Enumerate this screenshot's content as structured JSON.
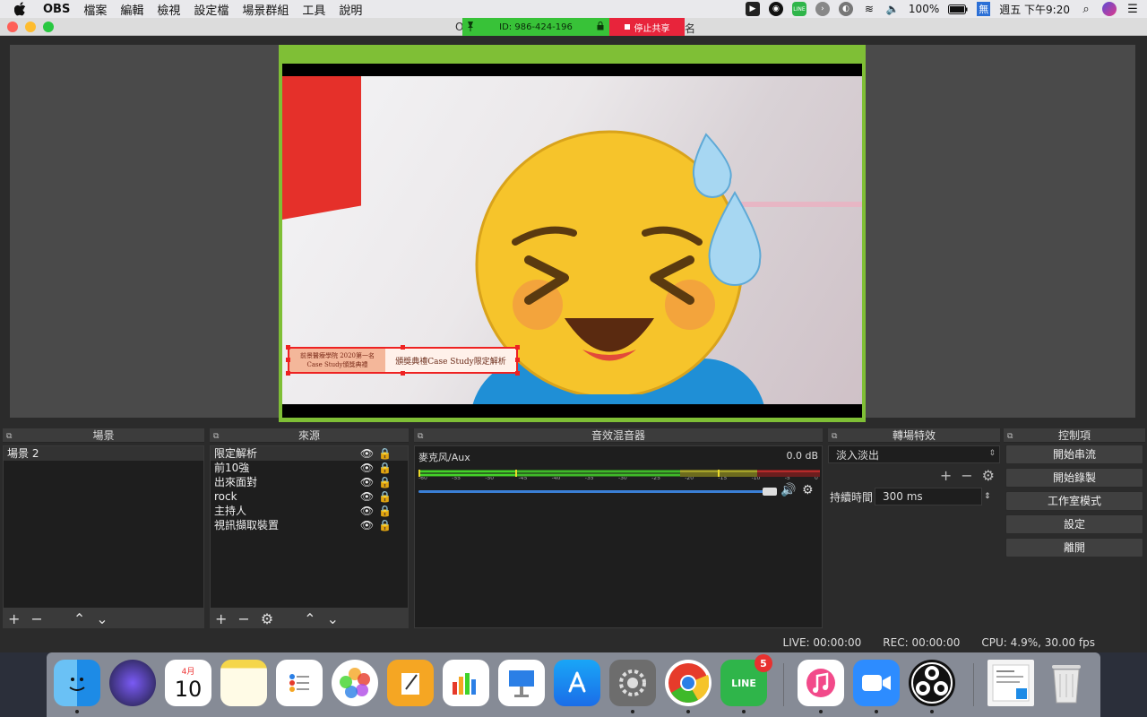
{
  "menubar": {
    "app": "OBS",
    "items": [
      "檔案",
      "編輯",
      "檢視",
      "設定檔",
      "場景群組",
      "工具",
      "說明"
    ],
    "battery": "100%",
    "ime": "無",
    "clock": "週五 下午9:20"
  },
  "window": {
    "title_left": "O",
    "title_right": "名",
    "share_id": "ID: 986-424-196",
    "stop_share": "停止共享"
  },
  "preview": {
    "lower_third_left_1": "前景醫療學院 2020第一名",
    "lower_third_left_2": "Case Study頒獎典禮",
    "lower_third_right": "頒獎典禮Case Study限定解析"
  },
  "scenes": {
    "title": "場景",
    "items": [
      "場景 2"
    ]
  },
  "sources": {
    "title": "來源",
    "items": [
      "限定解析",
      "前10強",
      "出來面對",
      "rock",
      "主持人",
      "視訊擷取裝置"
    ]
  },
  "mixer": {
    "title": "音效混音器",
    "channel": "麥克风/Aux",
    "level": "0.0 dB",
    "ticks": [
      "-60",
      "-55",
      "-50",
      "-45",
      "-40",
      "-35",
      "-30",
      "-25",
      "-20",
      "-15",
      "-10",
      "-5",
      "0"
    ]
  },
  "transitions": {
    "title": "轉場特效",
    "selected": "淡入淡出",
    "duration_label": "持續時間",
    "duration_value": "300 ms"
  },
  "controls": {
    "title": "控制項",
    "start_stream": "開始串流",
    "start_record": "開始錄製",
    "studio_mode": "工作室模式",
    "settings": "設定",
    "exit": "離開"
  },
  "status": {
    "live": "LIVE: 00:00:00",
    "rec": "REC: 00:00:00",
    "cpu": "CPU: 4.9%, 30.00 fps"
  },
  "dock": {
    "calendar_month": "4月",
    "calendar_day": "10",
    "line_label": "LINE",
    "line_badge": "5"
  },
  "colors": {
    "share_green": "#38c238",
    "stop_red": "#e8243b",
    "canvas_border": "#7fbf36",
    "selection_red": "#e22222",
    "fader_blue": "#3a7fd6"
  }
}
